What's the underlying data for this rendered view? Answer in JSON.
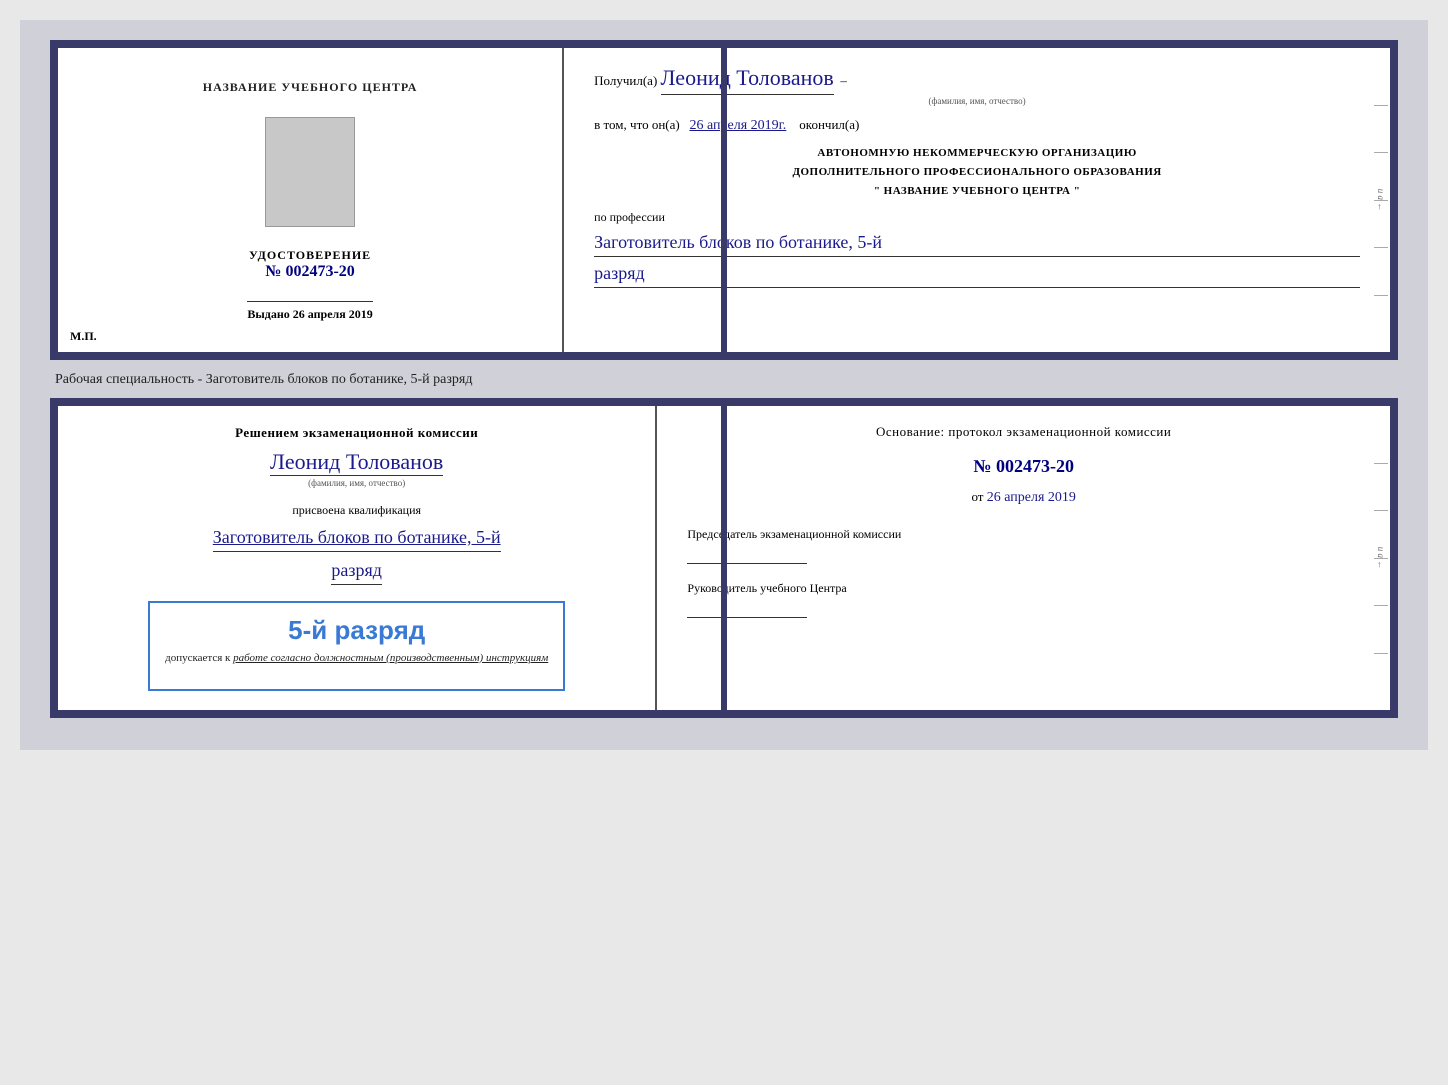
{
  "page": {
    "background_color": "#d0d0d8"
  },
  "doc1": {
    "left": {
      "title": "НАЗВАНИЕ УЧЕБНОГО ЦЕНТРА",
      "cert_label": "УДОСТОВЕРЕНИЕ",
      "cert_number_prefix": "№",
      "cert_number": "002473-20",
      "issued_label": "Выдано",
      "issued_date": "26 апреля 2019",
      "mp_label": "М.П."
    },
    "right": {
      "received_prefix": "Получил(а)",
      "recipient_name": "Леонид Толованов",
      "recipient_name_small": "(фамилия, имя, отчество)",
      "in_that_prefix": "в том, что он(а)",
      "completion_date": "26 апреля 2019г.",
      "completion_suffix": "окончил(а)",
      "org_line1": "АВТОНОМНУЮ НЕКОММЕРЧЕСКУЮ ОРГАНИЗАЦИЮ",
      "org_line2": "ДОПОЛНИТЕЛЬНОГО ПРОФЕССИОНАЛЬНОГО ОБРАЗОВАНИЯ",
      "org_line3": "\" НАЗВАНИЕ УЧЕБНОГО ЦЕНТРА \"",
      "profession_prefix": "по профессии",
      "profession_line1": "Заготовитель блоков по ботанике, 5-й",
      "rank_line": "разряд"
    }
  },
  "info_text": "Рабочая специальность - Заготовитель блоков по ботанике, 5-й разряд",
  "doc2": {
    "left": {
      "decision_text": "Решением экзаменационной комиссии",
      "person_name": "Леонид Толованов",
      "name_small": "(фамилия, имя, отчество)",
      "assigned_text": "присвоена квалификация",
      "profession_line1": "Заготовитель блоков по ботанике, 5-й",
      "rank_line": "разряд",
      "stamp_rank": "5-й разряд",
      "stamp_prefix": "допускается к",
      "stamp_italic": "работе согласно должностным (производственным) инструкциям"
    },
    "right": {
      "basis_text": "Основание: протокол экзаменационной комиссии",
      "protocol_number": "№ 002473-20",
      "from_prefix": "от",
      "from_date": "26 апреля 2019",
      "chairman_title": "Председатель экзаменационной комиссии",
      "director_title": "Руководитель учебного Центра"
    }
  }
}
